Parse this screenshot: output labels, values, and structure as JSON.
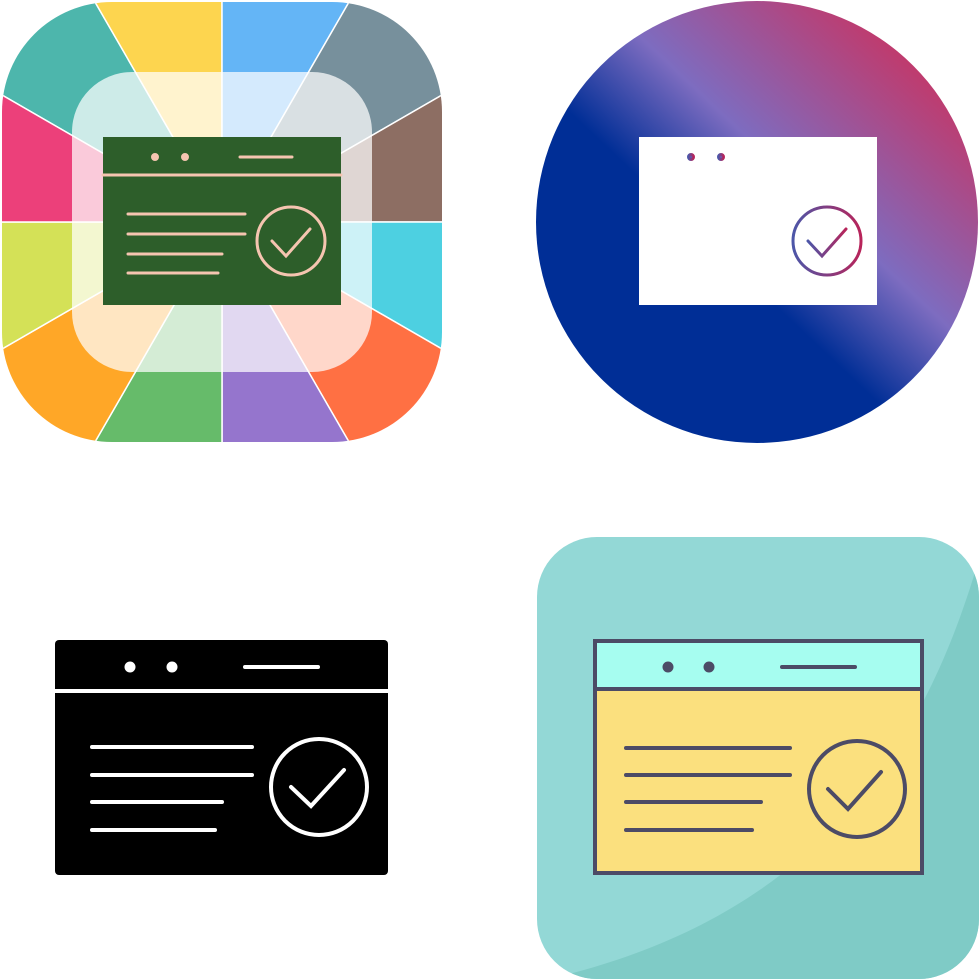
{
  "icon_set": {
    "subject": "browser-window-check-icon",
    "variants": [
      {
        "style": "multicolor-rounded-square",
        "window_fill": "#2d5e2a",
        "line_color": "#f5c5b0"
      },
      {
        "style": "gradient-circle",
        "gradient": [
          "#b8245a",
          "#7d6cc0",
          "#002e96"
        ],
        "window_fill": "#ffffff"
      },
      {
        "style": "glyph",
        "fill": "#000000",
        "line_color": "#ffffff"
      },
      {
        "style": "flat-rounded-square",
        "background": "#8fd6d3",
        "header_fill": "#a6fdf0",
        "window_fill": "#fbe07e",
        "stroke": "#4c4b66"
      }
    ]
  },
  "palette": {
    "segments": [
      "#4db6ac",
      "#fdd54f",
      "#64b5f6",
      "#77909c",
      "#8d6e63",
      "#4dd0e1",
      "#ff7043",
      "#9575cd",
      "#66bb6a",
      "#ffa727",
      "#d4e157",
      "#ec407a"
    ]
  }
}
